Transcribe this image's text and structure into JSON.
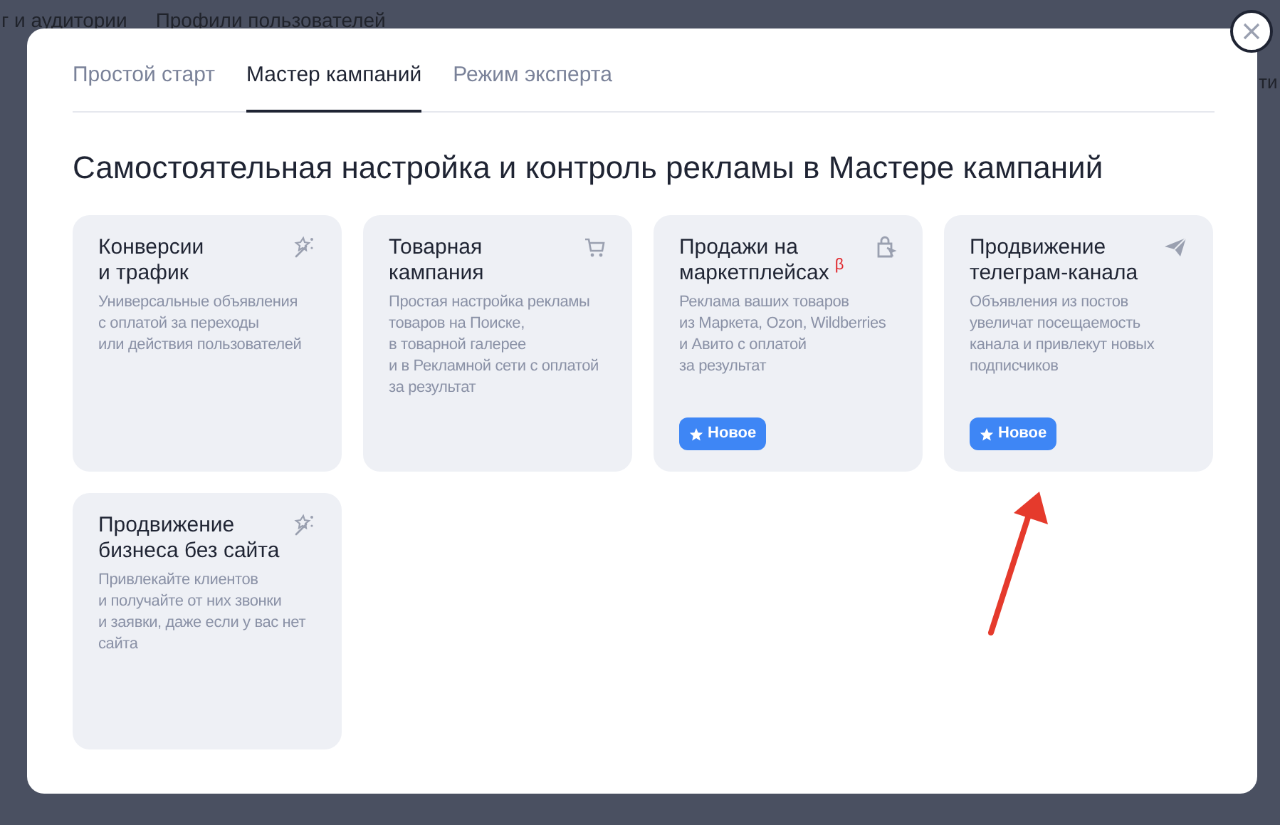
{
  "background_nav": [
    "г и аудитории",
    "Профили пользователей",
    "ти"
  ],
  "tabs": [
    {
      "label": "Простой старт",
      "selected": false
    },
    {
      "label": "Мастер кампаний",
      "selected": true
    },
    {
      "label": "Режим эксперта",
      "selected": false
    }
  ],
  "heading": "Самостоятельная настройка и контроль рекламы в Мастере кампаний",
  "cards": [
    {
      "title": "Конверсии\nи трафик",
      "kind": "magic",
      "description": "Универсальные объявления\nс оплатой за переходы\nили действия пользователей"
    },
    {
      "title": "Товарная\nкампания",
      "kind": "cart",
      "description": "Простая настройка рекламы\nтоваров на Поиске,\nв товарной галерее\nи в Рекламной сети с оплатой\nза результат"
    },
    {
      "title": "Продажи на\nмаркетплейсах",
      "title_mark": "β",
      "kind": "bag",
      "description": "Реклама ваших товаров\nиз Маркета, Ozon, Wildberries\nи Авито с оплатой\nза результат",
      "badge": "Новое"
    },
    {
      "title": "Продвижение\nтелеграм-канала",
      "kind": "plane",
      "description": "Объявления из постов\nувеличат посещаемость\nканала и привлекут новых\nподписчиков",
      "badge": "Новое"
    },
    {
      "title": "Продвижение\nбизнеса без сайта",
      "kind": "magic",
      "description": "Привлекайте клиентов\nи получайте от них звонки\nи заявки, даже если у вас нет\nсайта"
    }
  ]
}
